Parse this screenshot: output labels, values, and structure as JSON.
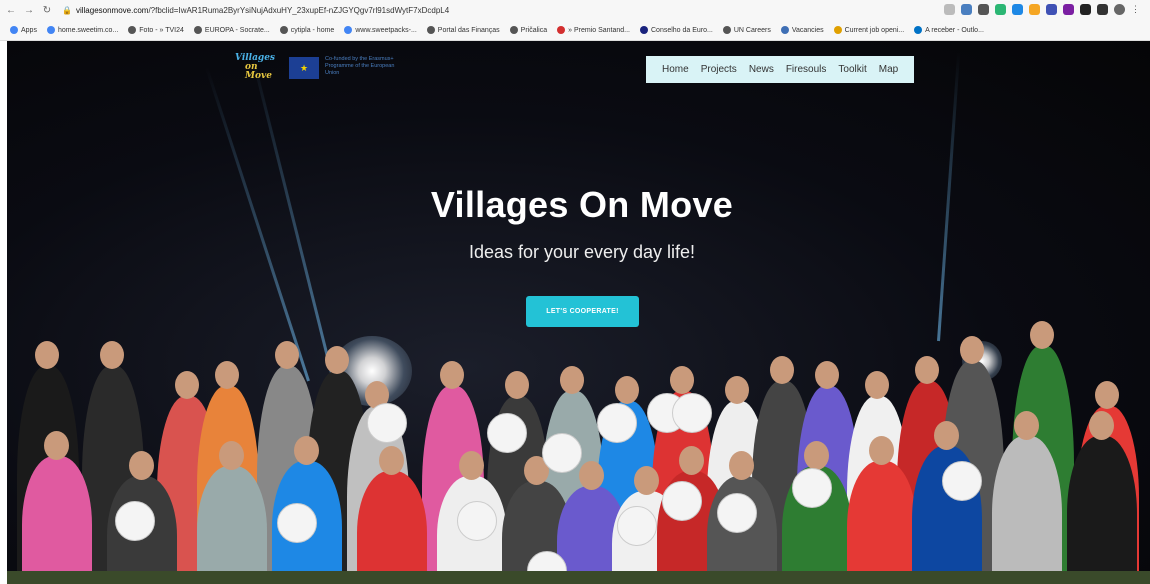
{
  "browser": {
    "url_host": "villagesonmove.com",
    "url_path": "/?fbclid=IwAR1Ruma2ByrYsiNujAdxuHY_23xupEf-nZJGYQgv7rl91sdWytF7xDcdpL4",
    "bookmarks": [
      {
        "label": "Apps",
        "color": "#4285f4"
      },
      {
        "label": "home.sweetim.co...",
        "color": "#4285f4"
      },
      {
        "label": "Foto - » TVI24",
        "color": "#555555"
      },
      {
        "label": "EUROPA - Socrate...",
        "color": "#555555"
      },
      {
        "label": "cytipla - home",
        "color": "#555555"
      },
      {
        "label": "www.sweetpacks-...",
        "color": "#4285f4"
      },
      {
        "label": "Portal das Finanças",
        "color": "#555555"
      },
      {
        "label": "Pričalica",
        "color": "#555555"
      },
      {
        "label": "» Premio Santand...",
        "color": "#d32f2f"
      },
      {
        "label": "Conselho da Euro...",
        "color": "#1a237e"
      },
      {
        "label": "UN Careers",
        "color": "#555555"
      },
      {
        "label": "Vacancies",
        "color": "#3f6fb5"
      },
      {
        "label": "Current job openi...",
        "color": "#e0a000"
      },
      {
        "label": "A receber - Outlo...",
        "color": "#0072c6"
      }
    ]
  },
  "site": {
    "logo_line1": "Villages",
    "logo_line2": "on Move",
    "eu_text": "Co-funded by the Erasmus+ Programme of the European Union",
    "menu": [
      "Home",
      "Projects",
      "News",
      "Firesouls",
      "Toolkit",
      "Map"
    ],
    "title": "Villages On Move",
    "subtitle": "Ideas for your every day life!",
    "cta": "LET'S COOPERATE!"
  },
  "colors": {
    "accent": "#23c2d6",
    "menu_bg": "#d9f3f6"
  }
}
